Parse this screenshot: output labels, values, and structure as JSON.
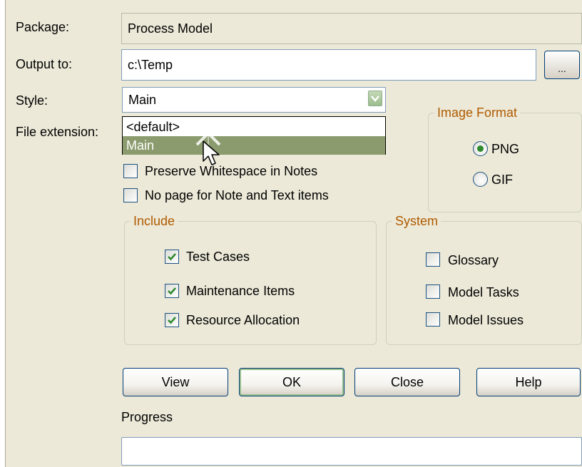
{
  "form": {
    "package_label": "Package:",
    "package_value": "Process Model",
    "output_label": "Output to:",
    "output_value": "c:\\Temp",
    "browse_label": "...",
    "style_label": "Style:",
    "style_value": "Main",
    "file_ext_label": "File extension:",
    "style_options": [
      "<default>",
      "Main"
    ],
    "style_selected_index": 1
  },
  "options": {
    "preserve_whitespace": {
      "label": "Preserve Whitespace in Notes",
      "checked": false
    },
    "no_page": {
      "label": "No page for Note and Text items",
      "checked": false
    }
  },
  "image_format": {
    "title": "Image Format",
    "png": {
      "label": "PNG",
      "selected": true
    },
    "gif": {
      "label": "GIF",
      "selected": false
    }
  },
  "include": {
    "title": "Include",
    "test_cases": {
      "label": "Test Cases",
      "checked": true
    },
    "maintenance": {
      "label": "Maintenance Items",
      "checked": true
    },
    "resource": {
      "label": "Resource Allocation",
      "checked": true
    }
  },
  "system": {
    "title": "System",
    "glossary": {
      "label": "Glossary",
      "checked": false
    },
    "tasks": {
      "label": "Model Tasks",
      "checked": false
    },
    "issues": {
      "label": "Model Issues",
      "checked": false
    }
  },
  "buttons": {
    "view": "View",
    "ok": "OK",
    "close": "Close",
    "help": "Help"
  },
  "progress": {
    "label": "Progress",
    "value": 0
  },
  "colors": {
    "dialog_bg": "#ece9d8",
    "group_title": "#b05a00",
    "selection": "#8b9b6d",
    "check": "#2d8a2d"
  }
}
